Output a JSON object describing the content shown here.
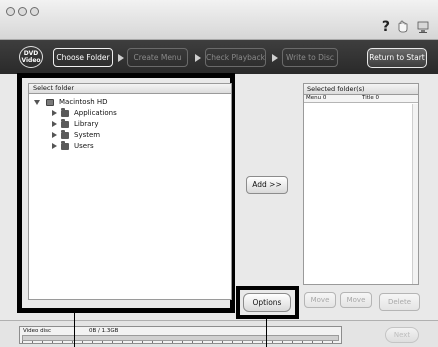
{
  "window": {
    "help_glyph": "?",
    "icons": [
      "help-icon",
      "hand-icon",
      "computer-icon"
    ]
  },
  "stepbar": {
    "logo_line1": "DVD",
    "logo_line2": "Video",
    "steps": [
      {
        "label": "Choose Folder",
        "active": true
      },
      {
        "label": "Create Menu",
        "active": false
      },
      {
        "label": "Check Playback",
        "active": false
      },
      {
        "label": "Write to Disc",
        "active": false
      }
    ],
    "return_label": "Return to Start"
  },
  "select_folder": {
    "header": "Select folder",
    "root": "Macintosh HD",
    "children": [
      "Applications",
      "Library",
      "System",
      "Users"
    ]
  },
  "add_label": "Add >>",
  "selected_folders": {
    "title": "Selected folder(s)",
    "col_menu": "Menu 0",
    "col_title": "Title 0"
  },
  "buttons": {
    "options": "Options",
    "move_down": "Move",
    "move_up": "Move",
    "delete": "Delete",
    "next": "Next"
  },
  "disc_meter": {
    "label": "Video disc",
    "size_text": "0B  / 1.3GB",
    "used_fraction": 0.0
  }
}
